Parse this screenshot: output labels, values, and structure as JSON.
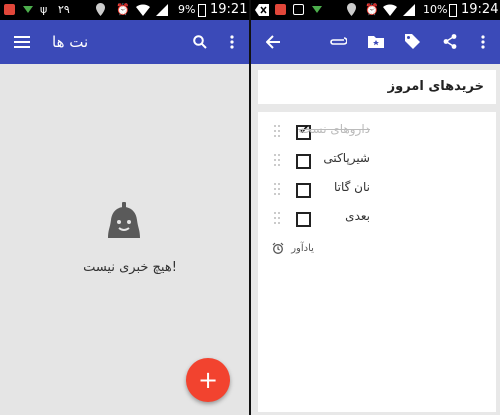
{
  "left": {
    "status": {
      "time": "19:21",
      "battery": "9%",
      "date_badge": "۲۹"
    },
    "appbar": {
      "title": "نت ها"
    },
    "empty": {
      "message": "هیچ خبری نیست!"
    },
    "fab": {
      "label": "+"
    },
    "colors": {
      "appbar": "#3b4ab8",
      "fab": "#f2432f"
    }
  },
  "right": {
    "status": {
      "time": "19:24",
      "battery": "10%"
    },
    "note": {
      "title": "خریدهای امروز",
      "items": [
        {
          "text": "داروهای نسخه",
          "checked": true
        },
        {
          "text": "شیرپاکتی",
          "checked": false
        },
        {
          "text": "نان گاتا",
          "checked": false
        },
        {
          "text": "بعدی",
          "checked": false
        }
      ],
      "reminder_label": "یادآور"
    }
  }
}
